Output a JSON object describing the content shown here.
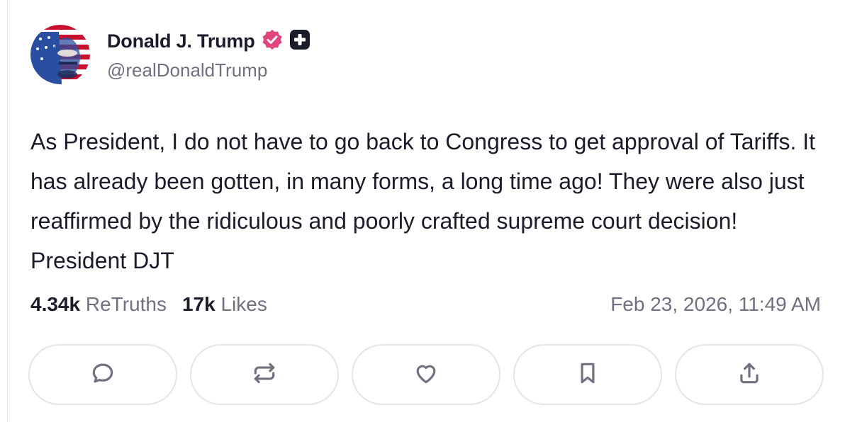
{
  "author": {
    "name": "Donald J. Trump",
    "handle": "@realDonaldTrump",
    "verified_badge_color": "#e0457b",
    "plus_badge_color": "#1b1c2a"
  },
  "post": {
    "text": "As President, I do not have to go back to Congress to get approval of Tariffs. It has already been gotten, in many forms, a long time ago! They were also just reaffirmed by the ridiculous and poorly crafted supreme court decision! President DJT",
    "retruths_count": "4.34k",
    "retruths_label": "ReTruths",
    "likes_count": "17k",
    "likes_label": "Likes",
    "timestamp": "Feb 23, 2026, 11:49 AM"
  },
  "actions": [
    {
      "name": "reply",
      "icon": "comment-icon"
    },
    {
      "name": "retruth",
      "icon": "repost-icon"
    },
    {
      "name": "like",
      "icon": "heart-icon"
    },
    {
      "name": "bookmark",
      "icon": "bookmark-icon"
    },
    {
      "name": "share",
      "icon": "share-icon"
    }
  ],
  "colors": {
    "text_primary": "#1b1c2a",
    "text_secondary": "#6f7180",
    "border": "#e4e4ea"
  }
}
